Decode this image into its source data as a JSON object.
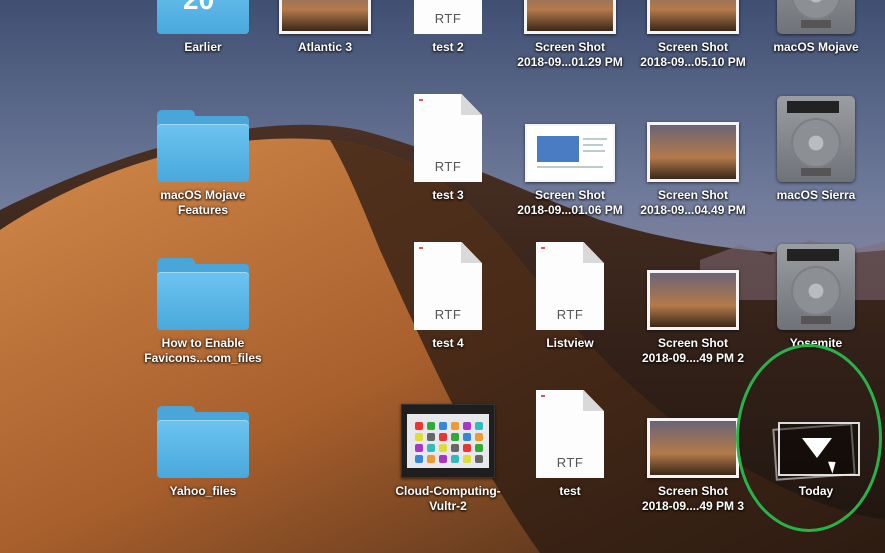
{
  "items": [
    {
      "label_lines": [
        "Earlier"
      ],
      "kind": "folder-partial",
      "thumb_text": "20"
    },
    {
      "label_lines": [
        "Atlantic 3"
      ],
      "kind": "screenshot-partial"
    },
    {
      "label_lines": [
        "test 2"
      ],
      "kind": "rtf",
      "ext": "RTF"
    },
    {
      "label_lines": [
        "Screen Shot",
        "2018-09...01.29 PM"
      ],
      "kind": "screenshot-partial"
    },
    {
      "label_lines": [
        "Screen Shot",
        "2018-09...05.10 PM"
      ],
      "kind": "screenshot-partial"
    },
    {
      "label_lines": [
        "macOS Mojave"
      ],
      "kind": "disk-partial"
    },
    {
      "label_lines": [
        "macOS Mojave",
        "Features"
      ],
      "kind": "folder"
    },
    {
      "label_lines": [
        "test 3"
      ],
      "kind": "rtf",
      "ext": "RTF"
    },
    {
      "label_lines": [
        "Screen Shot",
        "2018-09...01.06 PM"
      ],
      "kind": "screenshot-doc"
    },
    {
      "label_lines": [
        "Screen Shot",
        "2018-09...04.49 PM"
      ],
      "kind": "screenshot"
    },
    {
      "label_lines": [
        "macOS Sierra"
      ],
      "kind": "disk"
    },
    {
      "label_lines": [
        "How to Enable",
        "Favicons...com_files"
      ],
      "kind": "folder"
    },
    {
      "label_lines": [
        "test 4"
      ],
      "kind": "rtf",
      "ext": "RTF"
    },
    {
      "label_lines": [
        "Listview"
      ],
      "kind": "rtf",
      "ext": "RTF"
    },
    {
      "label_lines": [
        "Screen Shot",
        "2018-09....49 PM 2"
      ],
      "kind": "screenshot"
    },
    {
      "label_lines": [
        "Yosemite"
      ],
      "kind": "disk"
    },
    {
      "label_lines": [
        "Yahoo_files"
      ],
      "kind": "folder"
    },
    {
      "label_lines": [
        "Cloud-Computing-",
        "Vultr-2"
      ],
      "kind": "cloud"
    },
    {
      "label_lines": [
        "test"
      ],
      "kind": "rtf",
      "ext": "RTF"
    },
    {
      "label_lines": [
        "Screen Shot",
        "2018-09....49 PM 3"
      ],
      "kind": "screenshot"
    },
    {
      "label_lines": [
        "Today"
      ],
      "kind": "stack"
    }
  ],
  "colors": {
    "folder": "#4aa6d9",
    "annotation": "#2ab24a",
    "label": "#ffffff"
  }
}
